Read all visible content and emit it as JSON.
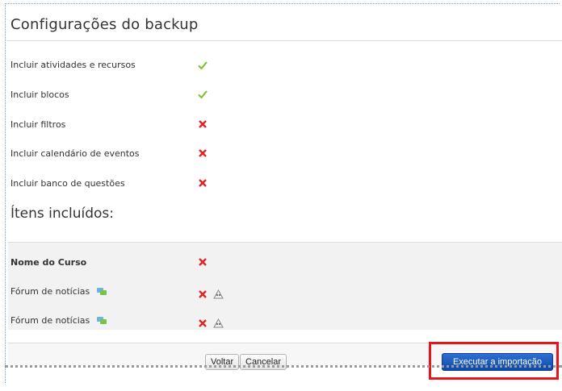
{
  "backup_settings": {
    "title": "Configurações do backup",
    "items": [
      {
        "label": "Incluir atividades e recursos",
        "status": "check"
      },
      {
        "label": "Incluir blocos",
        "status": "check"
      },
      {
        "label": "Incluir filtros",
        "status": "cross"
      },
      {
        "label": "Incluir calendário de eventos",
        "status": "cross"
      },
      {
        "label": "Incluir banco de questões",
        "status": "cross"
      }
    ]
  },
  "included_items": {
    "title": "Ítens incluídos:",
    "items": [
      {
        "label": "Nome do Curso",
        "status": "cross",
        "icon": null
      },
      {
        "label": "Fórum de notícias",
        "status": "cross",
        "icon": "forum-icon",
        "extra_icon": "people-icon"
      },
      {
        "label": "Fórum de notícias",
        "status": "cross",
        "icon": "forum-icon",
        "extra_icon": "people-icon"
      }
    ]
  },
  "buttons": {
    "back": "Voltar",
    "cancel": "Cancelar",
    "run_import": "Executar a importação"
  },
  "colors": {
    "check": "#7fbf2a",
    "cross": "#e02424",
    "primary": "#0b4aaa",
    "highlight": "#e8131b"
  }
}
